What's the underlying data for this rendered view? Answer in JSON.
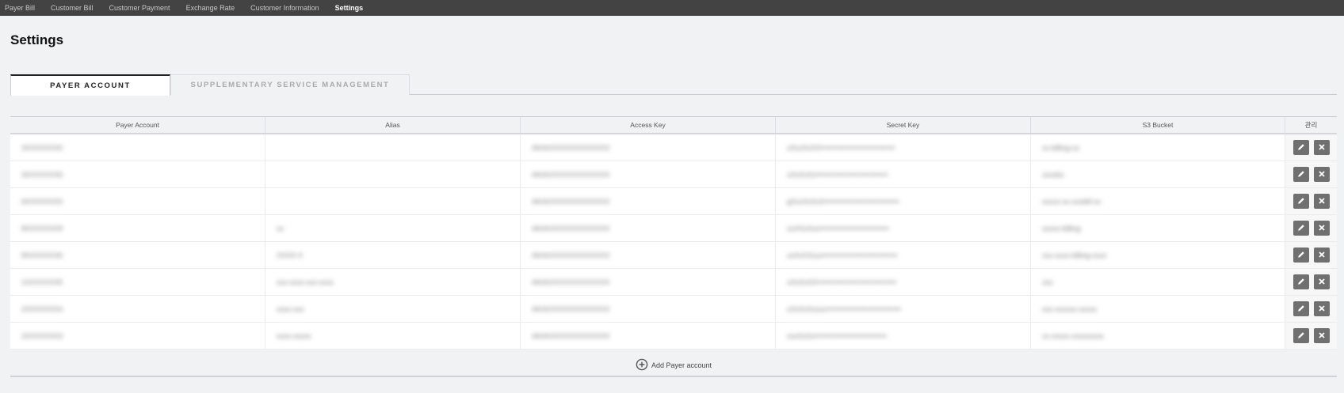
{
  "nav": {
    "items": [
      {
        "label": "Payer Bill"
      },
      {
        "label": "Customer Bill"
      },
      {
        "label": "Customer Payment"
      },
      {
        "label": "Exchange Rate"
      },
      {
        "label": "Customer Information"
      },
      {
        "label": "Settings",
        "active": true
      }
    ]
  },
  "page": {
    "title": "Settings"
  },
  "tabs": [
    {
      "label": "PAYER ACCOUNT",
      "active": true
    },
    {
      "label": "SUPPLEMENTARY SERVICE MANAGEMENT",
      "active": false
    }
  ],
  "table": {
    "columns": [
      "Payer Account",
      "Alias",
      "Access Key",
      "Secret Key",
      "S3 Bucket",
      "관리"
    ],
    "rows": [
      [
        "3XXXXXXX0",
        "",
        "AKIAXXXXXXXXXXXXX",
        "xXxxXxXX••••••••••••••••••••••••••••••",
        "xx-billing-xx"
      ],
      [
        "3XXXXXXX6",
        "",
        "AKIAXXXXXXXXXXXXX",
        "xXxXxXx•••••••••••••••••••••••••••••",
        "xxxxbx"
      ],
      [
        "6XXXXXXX0",
        "",
        "AKIAXXXXXXXXXXXXX",
        "gXxxXxXxX••••••••••••••••••••••••••••••",
        "xxxxx-xx-xxxbill-xx"
      ],
      [
        "8XXXXXXX9",
        "xx",
        "AKIAXXXXXXXXXXXXX",
        "xxXXxXxx••••••••••••••••••••••••••••",
        "xxxxx-billing"
      ],
      [
        "8XXXXXXX6",
        "XXXX-X",
        "AKIAXXXXXXXXXXXXX",
        "xxXxXXxxx••••••••••••••••••••••••••••••",
        "xxx-xxxx-billing-xxxx"
      ],
      [
        "1XXXXXXX5",
        "xxx-xxxx-xxx-xxxx",
        "AKIAXXXXXXXXXXXXX",
        "xXxXxXX••••••••••••••••••••••••••••••••",
        "xxx"
      ],
      [
        "2XXXXXXX4",
        "xxxx-xxx",
        "AKIAXXXXXXXXXXXXX",
        "xXxXxXxxxx••••••••••••••••••••••••••••••",
        "xxx-xxxxxx-xxxxx"
      ],
      [
        "2XXXXXXX3",
        "xxxx-xxxxx",
        "AKIAXXXXXXXXXXXXX",
        "xxxXxXx•••••••••••••••••••••••••••••",
        "xx-xxxxx-xxxxxxxxx"
      ]
    ]
  },
  "add_button": {
    "label": "Add Payer account"
  },
  "icons": {
    "edit": "pencil-icon",
    "delete": "close-icon",
    "add": "plus-circle-icon"
  },
  "colors": {
    "nav_bg": "#434343",
    "action_btn": "#707070",
    "page_bg": "#f1f2f4"
  }
}
